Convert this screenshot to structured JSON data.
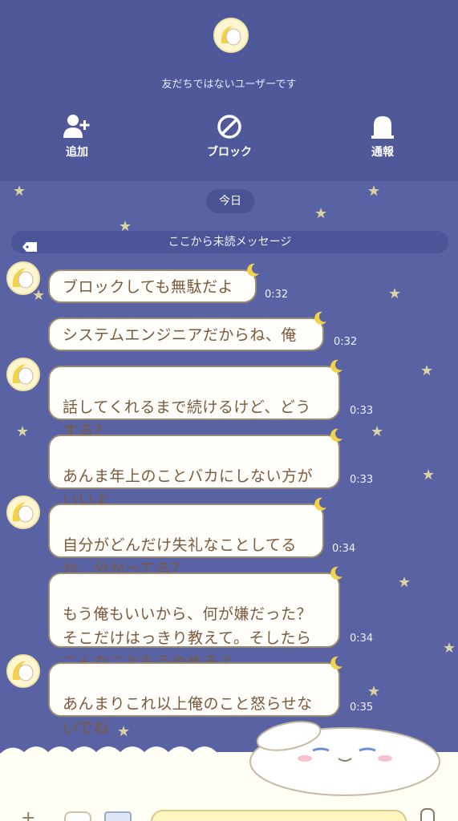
{
  "header": {
    "notice": "友だちではないユーザーです",
    "actions": [
      {
        "label": "追加",
        "icon": "add-friend-icon"
      },
      {
        "label": "ブロック",
        "icon": "block-icon"
      },
      {
        "label": "通報",
        "icon": "report-icon"
      }
    ]
  },
  "chat": {
    "date": "今日",
    "unread_divider": "ここから未読メッセージ",
    "messages": [
      {
        "text": "ブロックしても無駄だよ",
        "time": "0:32"
      },
      {
        "text": "システムエンジニアだからね、俺",
        "time": "0:32"
      },
      {
        "text": "話してくれるまで続けるけど、どう\nする？",
        "time": "0:33"
      },
      {
        "text": "あんま年上のことバカにしない方が\nいいよ",
        "time": "0:33"
      },
      {
        "text": "自分がどんだけ失礼なことしてる\nか、分かってる？",
        "time": "0:34"
      },
      {
        "text": "もう俺もいいから、何が嫌だった？\nそこだけはっきり教えて。そしたら\nこんなこともうやめるよ",
        "time": "0:34"
      },
      {
        "text": "あんまりこれ以上俺のこと怒らせな\nいでね",
        "time": "0:35"
      }
    ]
  },
  "theme": {
    "background": "#5962a2",
    "header_bg": "#4f5899",
    "bubble_border": "#9b8a74",
    "text_brown": "#7a5a3c",
    "star": "#e9e0a4"
  }
}
